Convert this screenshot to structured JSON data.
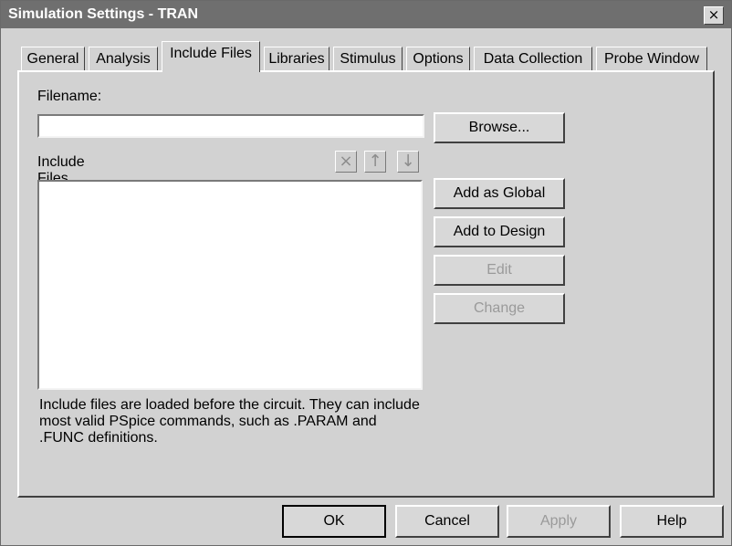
{
  "window": {
    "title": "Simulation Settings - TRAN",
    "close_symbol": "×"
  },
  "tabs": [
    {
      "label": "General",
      "active": false
    },
    {
      "label": "Analysis",
      "active": false
    },
    {
      "label": "Include Files",
      "active": true
    },
    {
      "label": "Libraries",
      "active": false
    },
    {
      "label": "Stimulus",
      "active": false
    },
    {
      "label": "Options",
      "active": false
    },
    {
      "label": "Data Collection",
      "active": false
    },
    {
      "label": "Probe Window",
      "active": false
    }
  ],
  "include_files": {
    "filename_label": "Filename:",
    "filename_value": "",
    "browse_label": "Browse...",
    "list_label": "Include Files",
    "delete_icon": "×",
    "up_icon": "↑",
    "down_icon": "↓",
    "add_global_label": "Add as Global",
    "add_design_label": "Add to Design",
    "edit_label": "Edit",
    "change_label": "Change",
    "description": "Include files are loaded before the circuit.  They can include most valid PSpice commands, such as .PARAM and .FUNC definitions."
  },
  "footer": {
    "ok_label": "OK",
    "cancel_label": "Cancel",
    "apply_label": "Apply",
    "help_label": "Help"
  }
}
